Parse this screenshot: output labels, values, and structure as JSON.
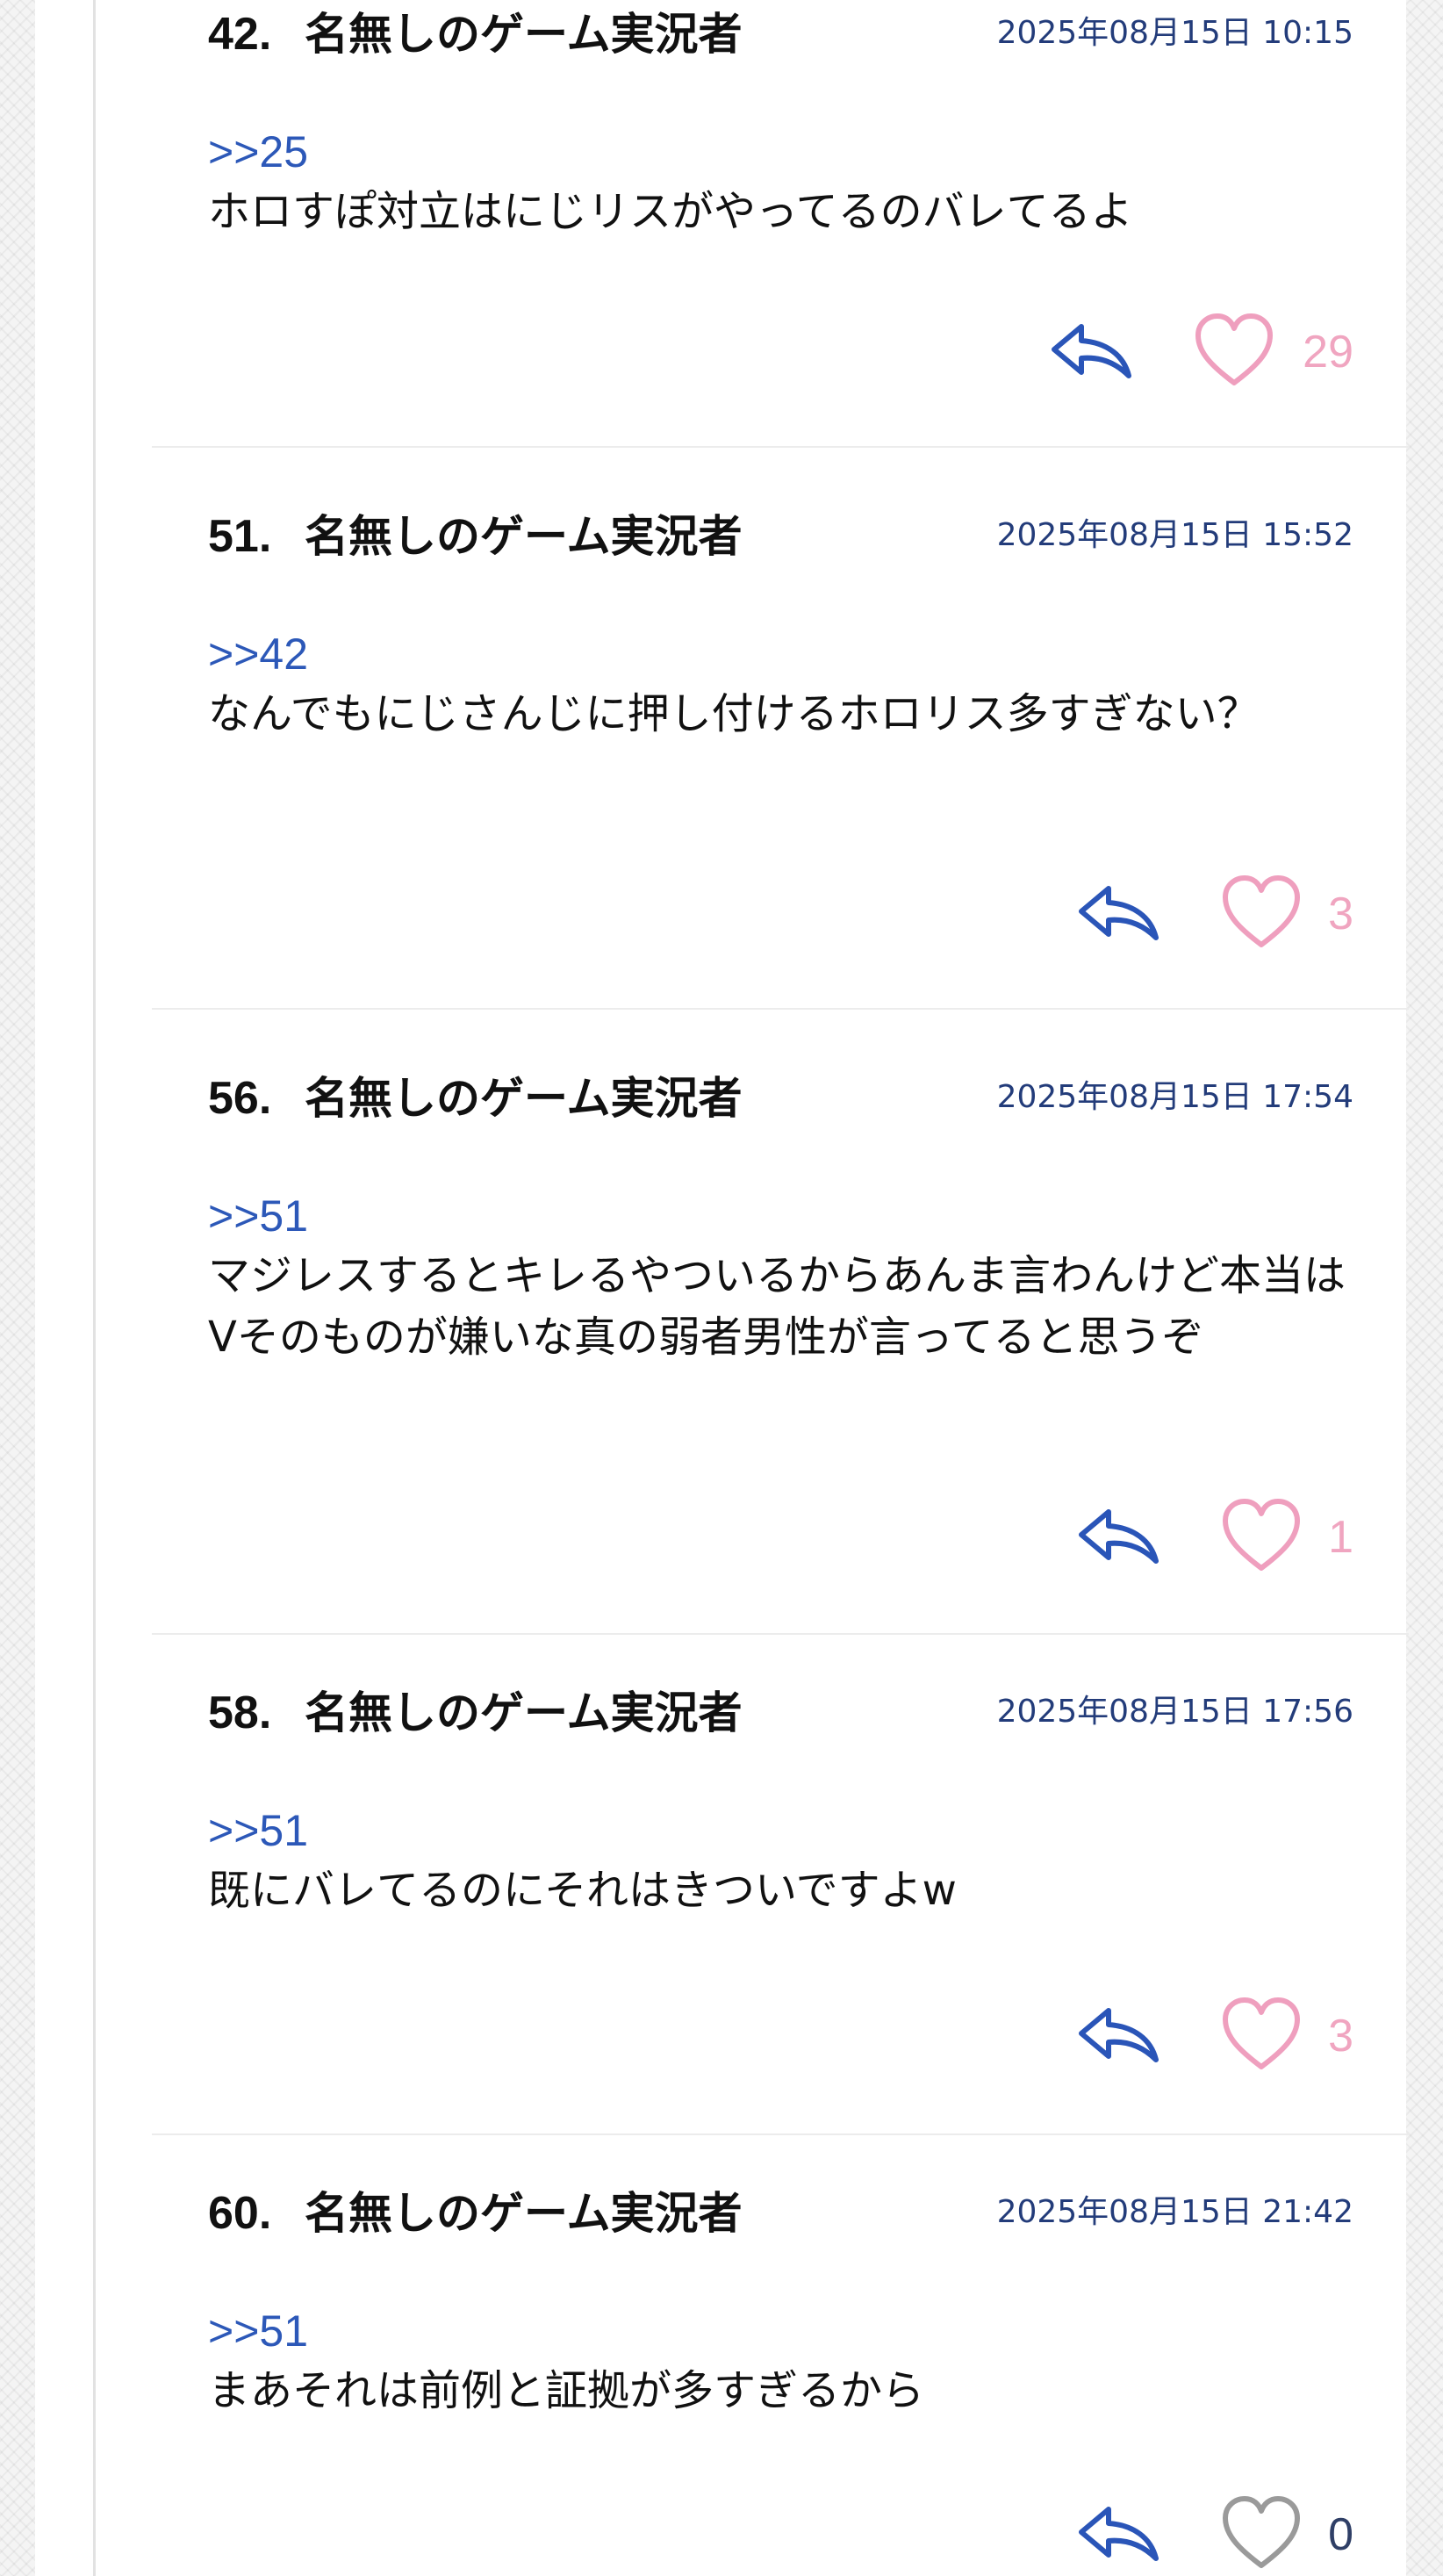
{
  "thread": {
    "colors": {
      "number": "#111111",
      "date": "#233c7a",
      "anchor": "#2c58b8",
      "reply_icon": "#2a55b8",
      "like_active": "#ef9fbe",
      "like_zero": "#9a9a9a"
    },
    "comments": [
      {
        "number": "42.",
        "name": "名無しのゲーム実況者",
        "date": "2025年08月15日 10:15",
        "anchor": ">>25",
        "body": "ホロすぽ対立はにじリスがやってるのバレてるよ",
        "likes": "29",
        "reply_icon": "reply-arrow-icon",
        "like_icon": "heart-outline-icon"
      },
      {
        "number": "51.",
        "name": "名無しのゲーム実況者",
        "date": "2025年08月15日 15:52",
        "anchor": ">>42",
        "body": "なんでもにじさんじに押し付けるホロリス多すぎない？",
        "likes": "3",
        "reply_icon": "reply-arrow-icon",
        "like_icon": "heart-outline-icon"
      },
      {
        "number": "56.",
        "name": "名無しのゲーム実況者",
        "date": "2025年08月15日 17:54",
        "anchor": ">>51",
        "body": "マジレスするとキレるやついるからあんま言わんけど本当はVそのものが嫌いな真の弱者男性が言ってると思うぞ",
        "likes": "1",
        "reply_icon": "reply-arrow-icon",
        "like_icon": "heart-outline-icon"
      },
      {
        "number": "58.",
        "name": "名無しのゲーム実況者",
        "date": "2025年08月15日 17:56",
        "anchor": ">>51",
        "body": "既にバレてるのにそれはきついですよw",
        "likes": "3",
        "reply_icon": "reply-arrow-icon",
        "like_icon": "heart-outline-icon"
      },
      {
        "number": "60.",
        "name": "名無しのゲーム実況者",
        "date": "2025年08月15日 21:42",
        "anchor": ">>51",
        "body": "まあそれは前例と証拠が多すぎるから",
        "likes": "0",
        "reply_icon": "reply-arrow-icon",
        "like_icon": "heart-outline-icon"
      }
    ]
  }
}
